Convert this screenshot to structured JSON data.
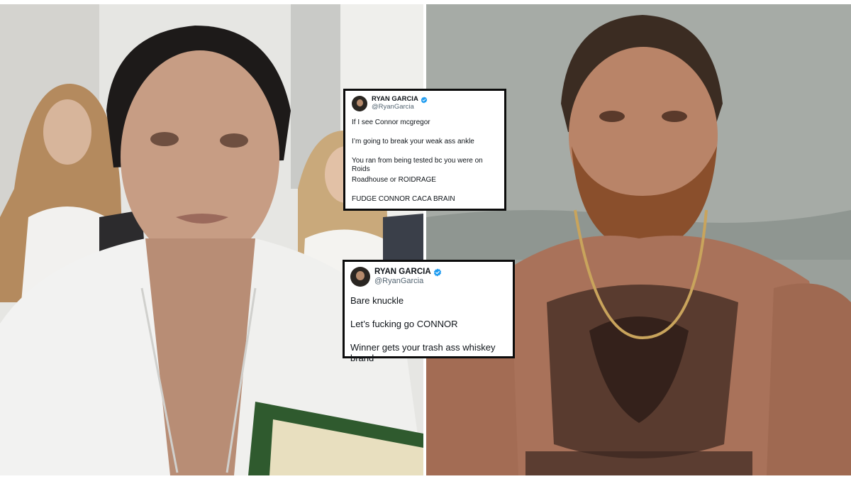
{
  "photos": {
    "left": {
      "subject": "man-in-white-jacket-selfie"
    },
    "right": {
      "subject": "bearded-tattooed-man-by-water"
    }
  },
  "tweets": [
    {
      "name": "RYAN GARCIA",
      "handle": "@RyanGarcia",
      "verified_icon": "verified-badge-icon",
      "lines": [
        "If I see Connor mcgregor",
        "I’m going to break your weak ass ankle",
        "You ran from being tested bc you were on Roids",
        "Roadhouse or ROIDRAGE",
        "FUDGE CONNOR CACA BRAIN"
      ]
    },
    {
      "name": "RYAN GARCIA",
      "handle": "@RyanGarcia",
      "verified_icon": "verified-badge-icon",
      "lines": [
        "Bare knuckle",
        "Let’s fucking go CONNOR",
        "Winner gets your trash ass whiskey brand"
      ]
    }
  ],
  "colors": {
    "verified": "#1d9bf0",
    "tweet_border": "#0c0c0c",
    "handle": "#536471"
  }
}
